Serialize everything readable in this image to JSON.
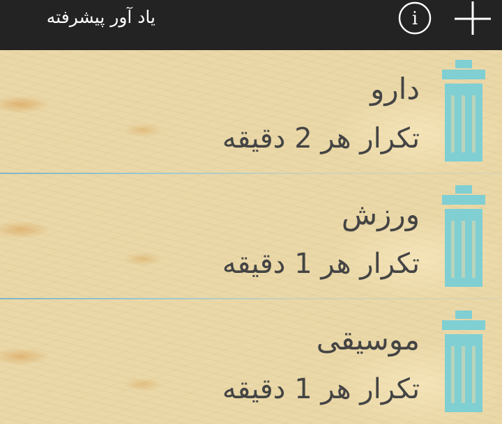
{
  "app_bar": {
    "title": "یاد آور پیشرفته",
    "info_icon": "info-circle-icon",
    "add_icon": "plus-icon"
  },
  "reminders": [
    {
      "title": "دارو",
      "subtitle": "تکرار هر 2 دقیقه"
    },
    {
      "title": "ورزش",
      "subtitle": "تکرار هر 1 دقیقه"
    },
    {
      "title": "موسیقی",
      "subtitle": "تکرار هر 1 دقیقه"
    }
  ],
  "colors": {
    "app_bar_bg": "#232323",
    "trash_icon": "#7fcfd3",
    "divider": "#8ec0cc",
    "text": "#444444"
  }
}
